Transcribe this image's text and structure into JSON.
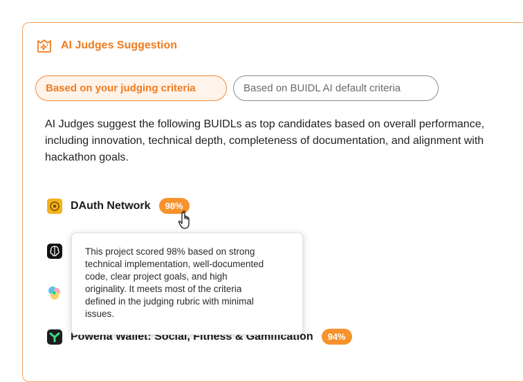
{
  "panel": {
    "title": "AI Judges Suggestion",
    "icon": "ai-spark-icon",
    "accent_color": "#f07b1d"
  },
  "tabs": [
    {
      "label": "Based on your judging criteria",
      "active": true
    },
    {
      "label": "Based on BUIDL AI default criteria",
      "active": false
    }
  ],
  "description": "AI Judges suggest the following BUIDLs as top candidates based on overall performance,\nincluding innovation, technical depth, completeness of documentation, and alignment with\nhackathon goals.",
  "buidls": [
    {
      "name": "DAuth Network",
      "score": "98%",
      "logo": "dauth-logo"
    },
    {
      "name": "",
      "score": "",
      "logo": "brain-logo"
    },
    {
      "name": "",
      "score": "",
      "logo": "colorful-logo"
    },
    {
      "name": "Powena Wallet: Social, Fitness & Gamification",
      "score": "94%",
      "logo": "powena-logo"
    }
  ],
  "tooltip": {
    "text": "This project scored 98% based on strong\ntechnical implementation, well-documented\ncode, clear project goals, and high\noriginality. It meets most of the criteria\ndefined in the judging rubric with minimal\nissues."
  }
}
